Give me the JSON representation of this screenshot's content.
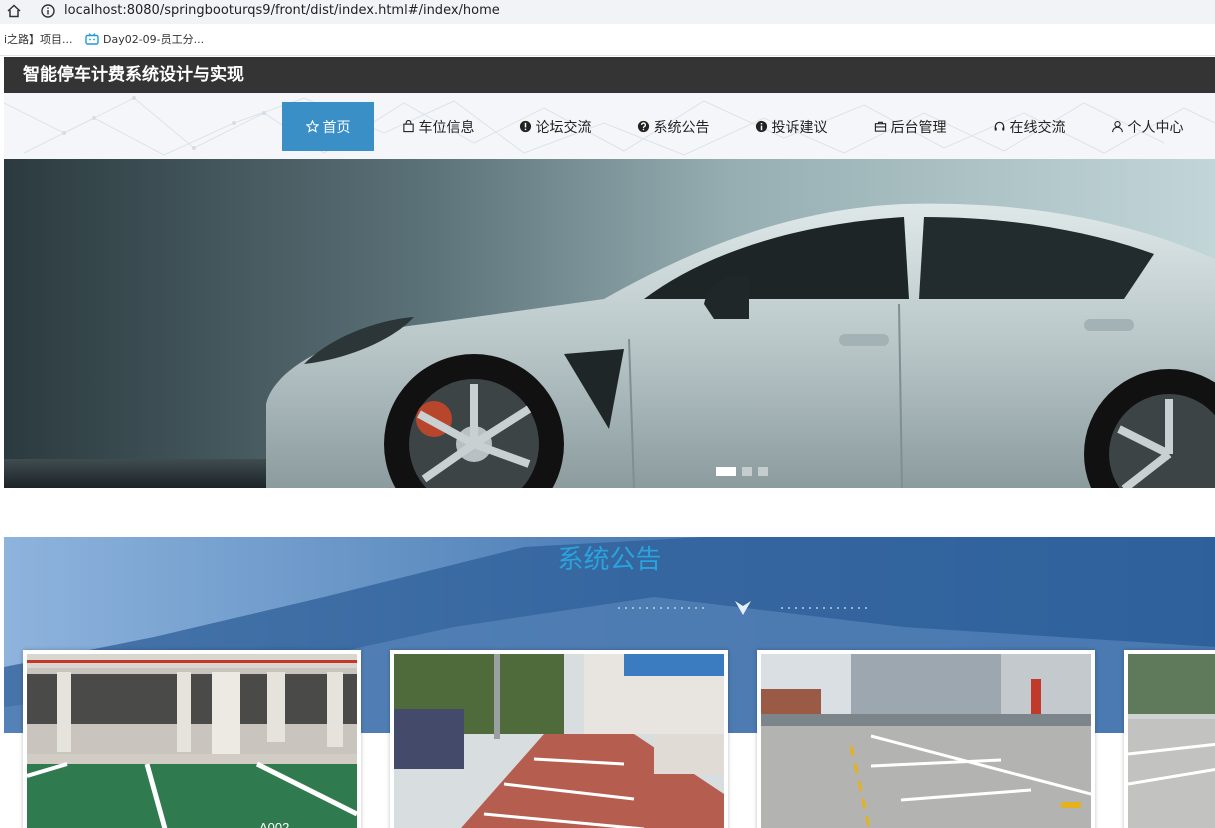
{
  "browser": {
    "url": "localhost:8080/springbooturqs9/front/dist/index.html#/index/home",
    "bookmarks": [
      {
        "label": "i之路】项目..."
      },
      {
        "label": "Day02-09-员工分..."
      }
    ]
  },
  "site": {
    "title": "智能停车计费系统设计与实现"
  },
  "nav": {
    "items": [
      {
        "label": "首页",
        "icon": "star-icon",
        "active": true
      },
      {
        "label": "车位信息",
        "icon": "bag-icon"
      },
      {
        "label": "论坛交流",
        "icon": "exclamation-icon"
      },
      {
        "label": "系统公告",
        "icon": "question-icon"
      },
      {
        "label": "投诉建议",
        "icon": "info-icon"
      },
      {
        "label": "后台管理",
        "icon": "briefcase-icon"
      },
      {
        "label": "在线交流",
        "icon": "headset-icon"
      },
      {
        "label": "个人中心",
        "icon": "user-icon"
      }
    ]
  },
  "carousel": {
    "slide_count": 3,
    "active_index": 0
  },
  "notice": {
    "title": "系统公告"
  },
  "colors": {
    "header_bg": "#343434",
    "nav_active": "#3a8fc6",
    "notice_title": "#2aa3dd"
  }
}
